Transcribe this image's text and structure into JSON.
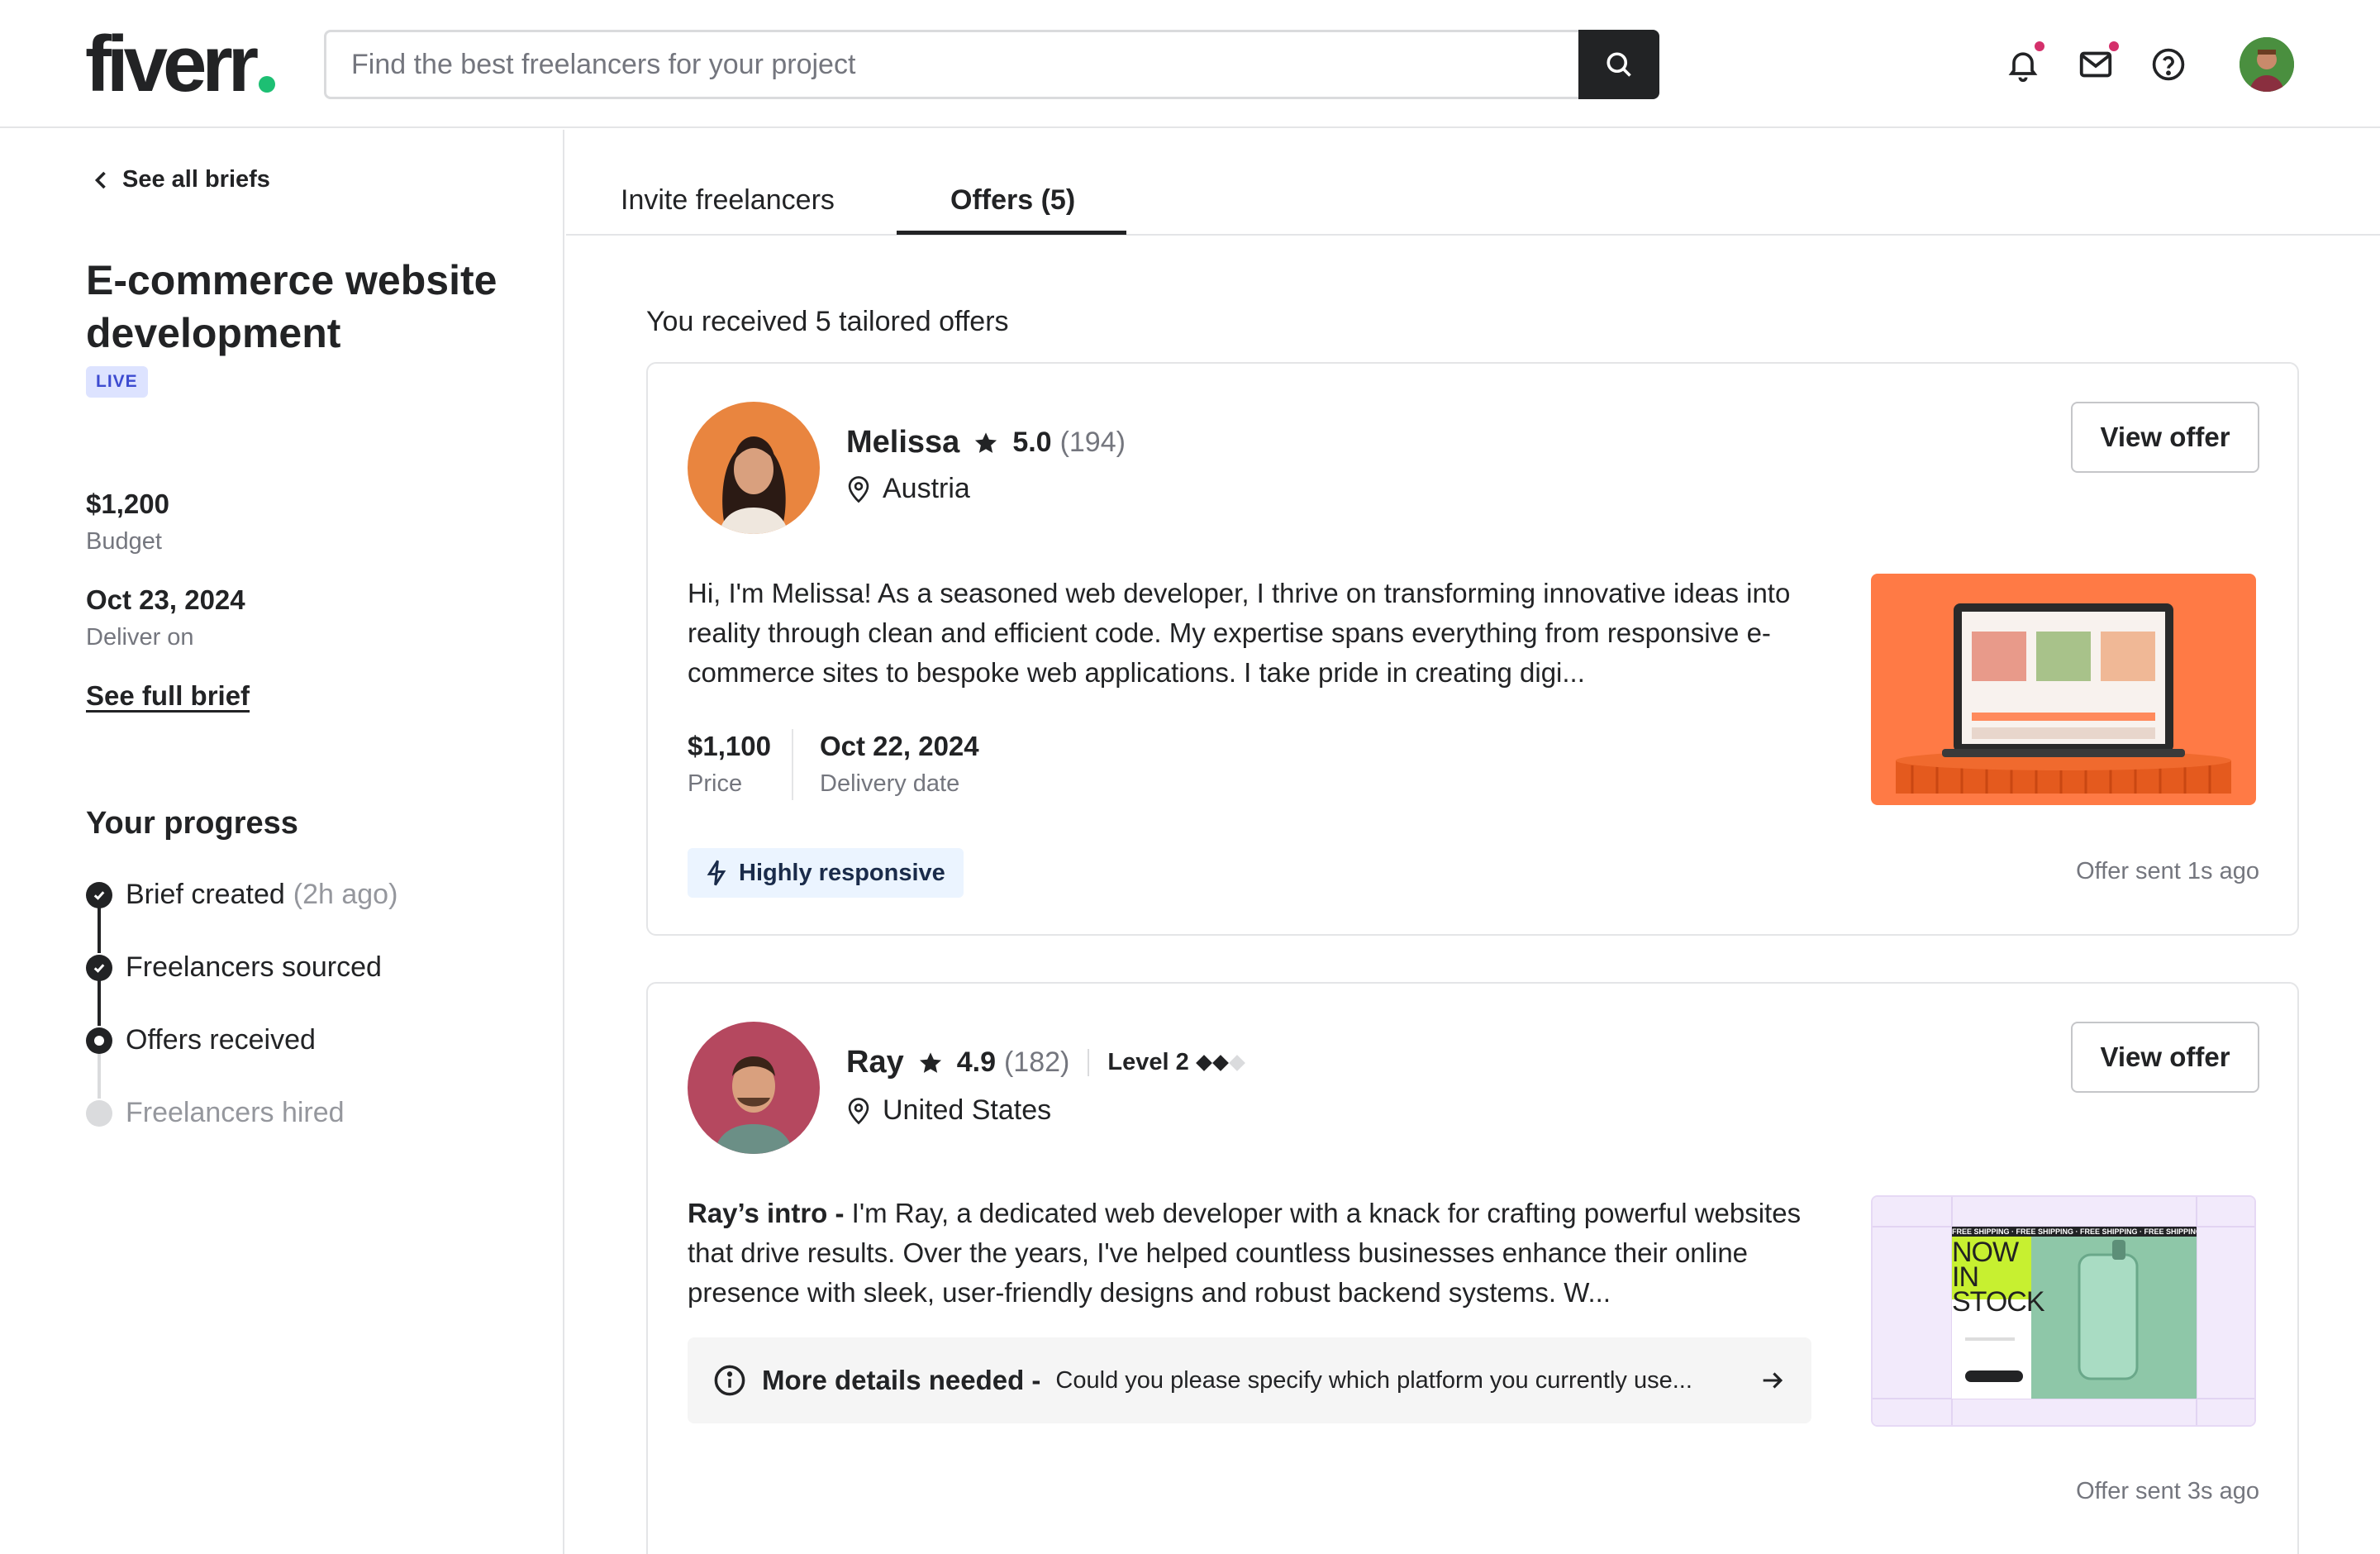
{
  "header": {
    "logo": "fiverr",
    "search_placeholder": "Find the best freelancers for your project",
    "icons": [
      "bell-icon",
      "mail-icon",
      "help-icon",
      "user-avatar"
    ]
  },
  "sidebar": {
    "back_label": "See all briefs",
    "title": "E-commerce website development",
    "status": "LIVE",
    "budget_value": "$1,200",
    "budget_label": "Budget",
    "deliver_value": "Oct 23, 2024",
    "deliver_label": "Deliver on",
    "see_full": "See full brief",
    "progress_title": "Your progress",
    "steps": [
      {
        "label": "Brief created",
        "time": "(2h ago)",
        "state": "done"
      },
      {
        "label": "Freelancers sourced",
        "time": "",
        "state": "done"
      },
      {
        "label": "Offers received",
        "time": "",
        "state": "current"
      },
      {
        "label": "Freelancers hired",
        "time": "",
        "state": "pending"
      }
    ]
  },
  "tabs": [
    {
      "label": "Invite freelancers",
      "active": false
    },
    {
      "label": "Offers (5)",
      "active": true
    }
  ],
  "main": {
    "received_text": "You received 5 tailored offers",
    "offers": [
      {
        "name": "Melissa",
        "rating": "5.0",
        "reviews": "(194)",
        "location": "Austria",
        "button": "View offer",
        "description": "Hi, I'm Melissa! As a seasoned web developer, I thrive on transforming innovative ideas into reality through clean and efficient code. My expertise spans everything from responsive e-commerce sites to bespoke web applications. I take pride in creating digi...",
        "price_value": "$1,100",
        "price_label": "Price",
        "delivery_value": "Oct 22, 2024",
        "delivery_label": "Delivery date",
        "badge": "Highly responsive",
        "sent": "Offer sent 1s ago"
      },
      {
        "name": "Ray",
        "rating": "4.9",
        "reviews": "(182)",
        "level": "Level 2",
        "location": "United States",
        "button": "View offer",
        "intro_label": "Ray’s intro -",
        "description": "I'm Ray, a dedicated web developer with a knack for crafting powerful websites that drive results. Over the years, I've helped countless businesses enhance their online presence with sleek, user-friendly designs and robust backend systems. W...",
        "details_title": "More details needed -",
        "details_text": "Could you please specify which platform you currently use...",
        "thumb_text": "NOW IN STOCK",
        "thumb_banner": "FREE SHIPPING · FREE SHIPPING · FREE SHIPPING · FREE SHIPPING",
        "sent": "Offer sent 3s ago"
      }
    ]
  },
  "colors": {
    "brand_green": "#1dbf73",
    "live_badge": "#dde3ff",
    "ray_avatar_bg": "#b5485f",
    "melissa_avatar_bg": "#e9853f"
  }
}
